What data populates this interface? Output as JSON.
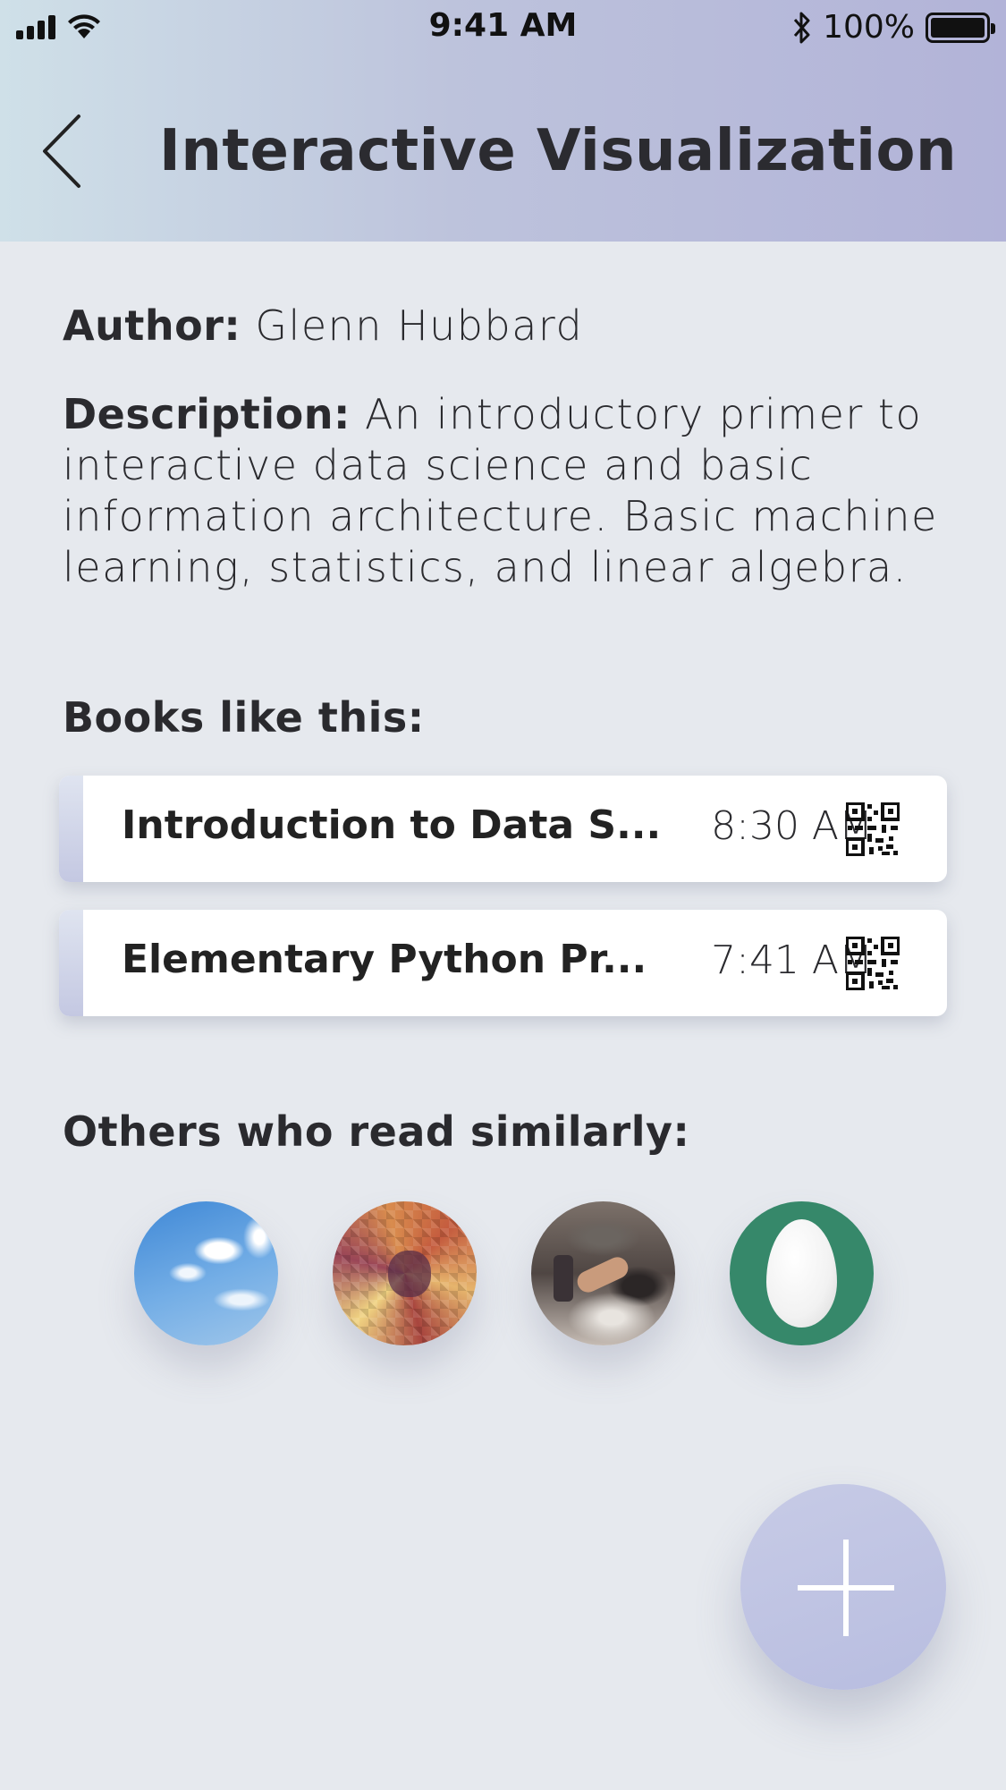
{
  "status_bar": {
    "time": "9:41 AM",
    "battery_percent": "100%",
    "icons": [
      "signal-icon",
      "wifi-icon",
      "bluetooth-icon",
      "battery-icon"
    ]
  },
  "header": {
    "title": "Interactive Visualization",
    "back_icon": "chevron-left-icon",
    "gradient_colors": [
      "#cfe0e8",
      "#b2b3d8"
    ]
  },
  "details": {
    "author_label": "Author:",
    "author_value": "Glenn Hubbard",
    "description_label": "Description:",
    "description_value": "An introductory primer to interactive data science and basic information architecture. Basic machine learning, statistics, and linear algebra."
  },
  "similar_books": {
    "heading": "Books like this:",
    "items": [
      {
        "title": "Introduction to Data S...",
        "time": "8:30 AM",
        "icon": "qr-code-icon"
      },
      {
        "title": "Elementary Python Pr...",
        "time": "7:41 AM",
        "icon": "qr-code-icon"
      }
    ]
  },
  "similar_readers": {
    "heading": "Others who read similarly:",
    "avatars": [
      "sky-avatar",
      "pixel-art-avatar",
      "photo-avatar",
      "egg-avatar"
    ]
  },
  "fab": {
    "icon": "plus-icon",
    "color": "#bfc3e3"
  }
}
